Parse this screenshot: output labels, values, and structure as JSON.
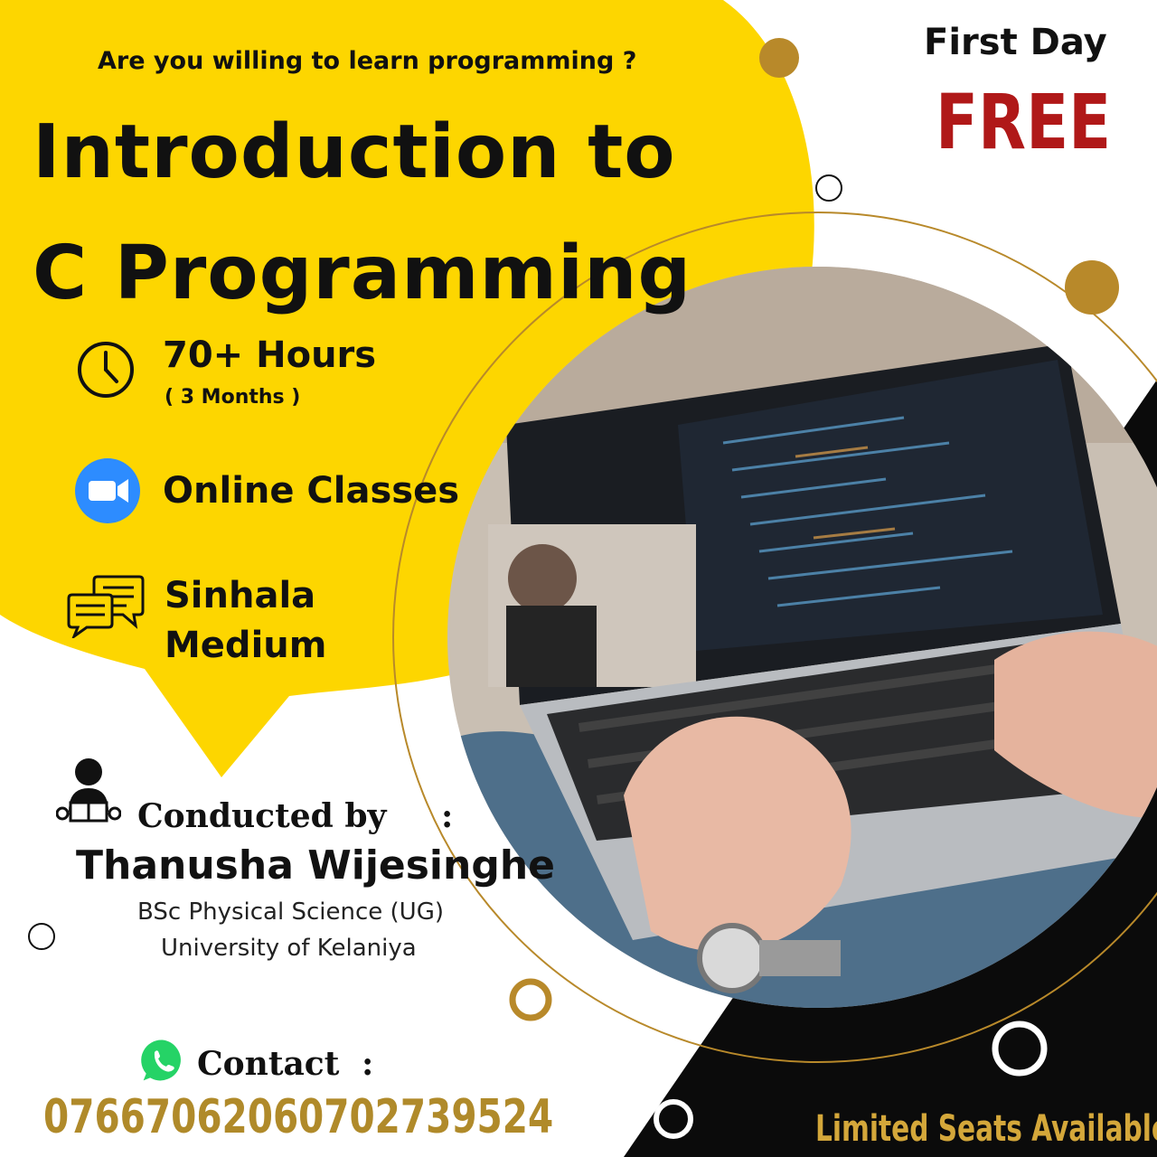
{
  "header": {
    "tagline": "Are you willing to learn programming ?",
    "title_line1": "Introduction to",
    "title_line2": "C Programming"
  },
  "promo": {
    "first_day": "First Day",
    "free": "FREE"
  },
  "features": [
    {
      "icon": "clock-icon",
      "label": "70+ Hours",
      "sublabel": "( 3 Months )"
    },
    {
      "icon": "video-camera-icon",
      "label": "Online Classes"
    },
    {
      "icon": "chat-bubbles-icon",
      "label_line1": "Sinhala",
      "label_line2": "Medium"
    }
  ],
  "instructor": {
    "conducted_by": "Conducted  by",
    "colon": ":",
    "name": "Thanusha Wijesinghe",
    "degree": "BSc Physical Science (UG)",
    "university": "University of Kelaniya"
  },
  "contact": {
    "label": "Contact",
    "colon": ":",
    "phones": [
      "0766706206",
      "0702739524"
    ]
  },
  "footer": {
    "limited": "Limited Seats Available"
  },
  "colors": {
    "yellow": "#fdd600",
    "gold": "#b8892a",
    "red": "#b01818",
    "black": "#0b0b0b",
    "zoom_blue": "#2d8cff",
    "whatsapp_green": "#25d366"
  }
}
